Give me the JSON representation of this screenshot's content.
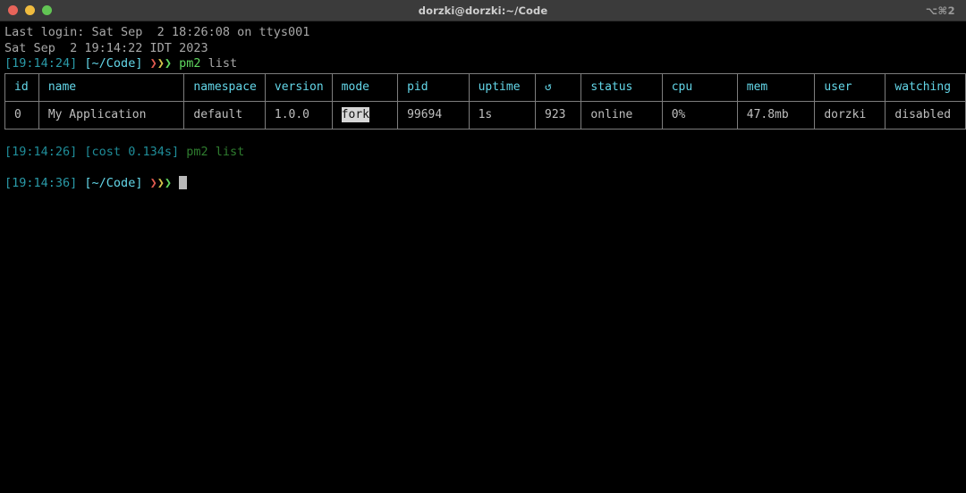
{
  "window": {
    "title": "dorzki@dorzki:~/Code",
    "shortcut": "⌥⌘2",
    "traffic_lights": [
      {
        "name": "close",
        "color": "#e8645a"
      },
      {
        "name": "minimize",
        "color": "#f0bc3f"
      },
      {
        "name": "zoom",
        "color": "#62c554"
      }
    ]
  },
  "terminal": {
    "lines": {
      "last_login": "Last login: Sat Sep  2 18:26:08 on ttys001",
      "date_line": "Sat Sep  2 19:14:22 IDT 2023"
    },
    "prompt1": {
      "time": "[19:14:24]",
      "path": "[~/Code]",
      "arrows": "❯❯❯",
      "command_name": "pm2",
      "command_args": " list"
    },
    "cost_line": {
      "time": "[19:14:26]",
      "cost": "[cost 0.134s]",
      "command": "pm2 list"
    },
    "prompt2": {
      "time": "[19:14:36]",
      "path": "[~/Code]",
      "arrows": "❯❯❯"
    }
  },
  "pm2_table": {
    "columns": [
      {
        "key": "id",
        "label": "id",
        "width": 38
      },
      {
        "key": "name",
        "label": "name",
        "width": 165
      },
      {
        "key": "namespace",
        "label": "namespace",
        "width": 90
      },
      {
        "key": "version",
        "label": "version",
        "width": 72
      },
      {
        "key": "mode",
        "label": "mode",
        "width": 75
      },
      {
        "key": "pid",
        "label": "pid",
        "width": 81
      },
      {
        "key": "uptime",
        "label": "uptime",
        "width": 75
      },
      {
        "key": "restarts",
        "label": "↺",
        "width": 52
      },
      {
        "key": "status",
        "label": "status",
        "width": 92
      },
      {
        "key": "cpu",
        "label": "cpu",
        "width": 87
      },
      {
        "key": "mem",
        "label": "mem",
        "width": 88
      },
      {
        "key": "user",
        "label": "user",
        "width": 80
      },
      {
        "key": "watching",
        "label": "watching",
        "width": 90
      }
    ],
    "rows": [
      {
        "id": "0",
        "name": "My Application",
        "namespace": "default",
        "version": "1.0.0",
        "mode": "fork",
        "pid": "99694",
        "uptime": "1s",
        "restarts": "923",
        "status": "online",
        "cpu": "0%",
        "mem": "47.8mb",
        "user": "dorzki",
        "watching": "disabled"
      }
    ]
  },
  "colors": {
    "background": "#000000",
    "titlebar": "#3b3b3b",
    "header_cyan": "#63d6e8",
    "status_online": "#5fd75f",
    "border_gray": "#7d7d7d",
    "dim_gray": "#6b6b6b",
    "inverse_bg": "#d6d6d6"
  }
}
